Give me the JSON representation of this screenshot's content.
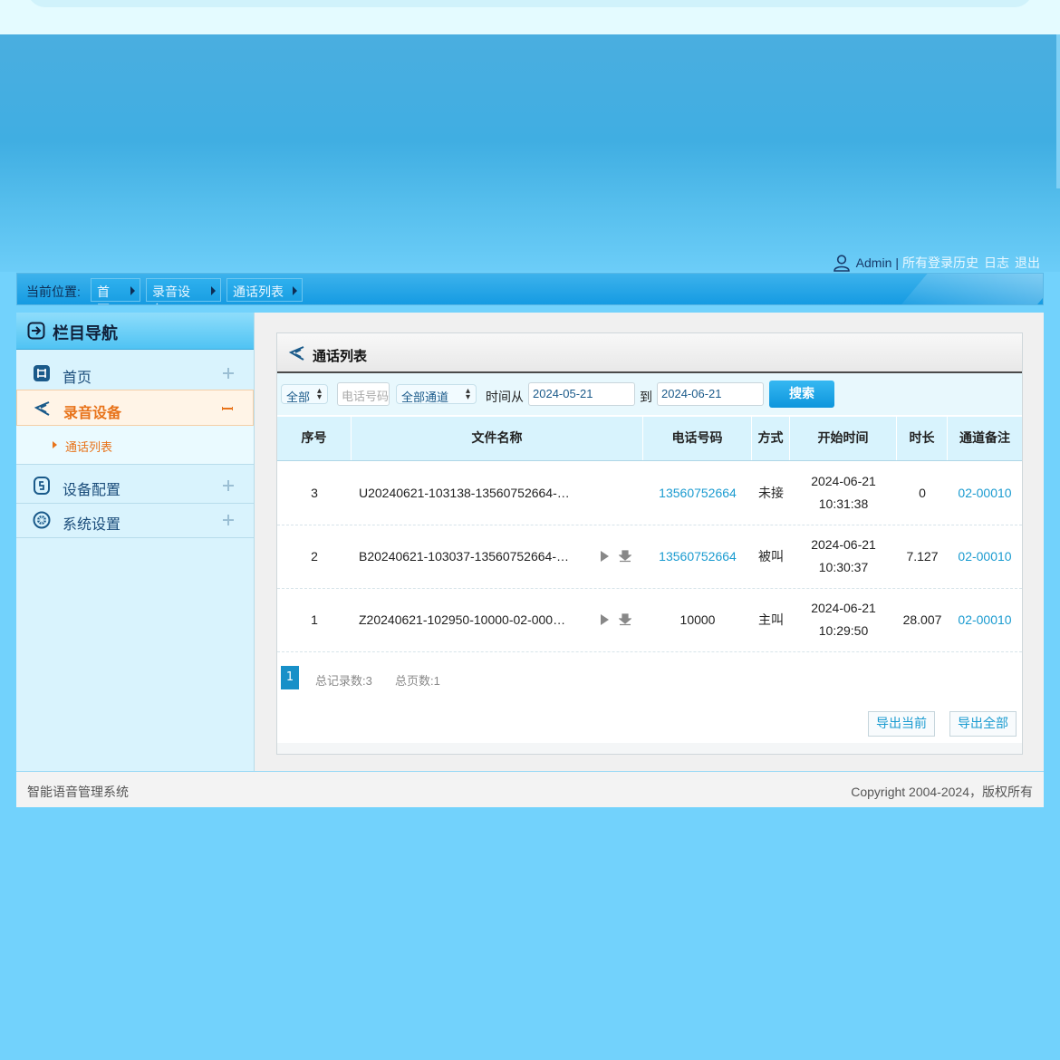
{
  "header": {
    "user": "Admin",
    "separator": "|",
    "links": [
      "所有登录历史",
      "日志",
      "退出"
    ]
  },
  "breadcrumb": {
    "label": "当前位置:",
    "items": [
      "首页",
      "录音设备",
      "通话列表"
    ]
  },
  "sidebar": {
    "title": "栏目导航",
    "items": [
      {
        "label": "首页",
        "icon": "home-grid-icon"
      },
      {
        "label": "录音设备",
        "icon": "recorder-icon"
      },
      {
        "label": "设备配置",
        "icon": "device-config-icon"
      },
      {
        "label": "系统设置",
        "icon": "system-settings-icon"
      }
    ],
    "subitems": [
      "通话列表"
    ]
  },
  "panel": {
    "title": "通话列表"
  },
  "search": {
    "type_select": "全部",
    "phone_placeholder": "电话号码",
    "channel_select": "全部通道",
    "time_from_label": "时间从",
    "date_from": "2024-05-21",
    "to_label": "到",
    "date_to": "2024-06-21",
    "search_button": "搜索"
  },
  "table": {
    "columns": [
      "序号",
      "文件名称",
      "电话号码",
      "方式",
      "开始时间",
      "时长",
      "通道备注"
    ],
    "rows": [
      {
        "index": "3",
        "file": "U20240621-103138-13560752664-…",
        "phone": "13560752664",
        "phone_link": true,
        "mode": "未接",
        "date": "2024-06-21",
        "time": "10:31:38",
        "duration": "0",
        "channel": "02-00010",
        "has_actions": false
      },
      {
        "index": "2",
        "file": "B20240621-103037-13560752664-…",
        "phone": "13560752664",
        "phone_link": true,
        "mode": "被叫",
        "date": "2024-06-21",
        "time": "10:30:37",
        "duration": "7.127",
        "channel": "02-00010",
        "has_actions": true
      },
      {
        "index": "1",
        "file": "Z20240621-102950-10000-02-000…",
        "phone": "10000",
        "phone_link": false,
        "mode": "主叫",
        "date": "2024-06-21",
        "time": "10:29:50",
        "duration": "28.007",
        "channel": "02-00010",
        "has_actions": true
      }
    ]
  },
  "pager": {
    "current": "1",
    "total_records": "总记录数:3",
    "total_pages": "总页数:1"
  },
  "export": {
    "current": "导出当前",
    "all": "导出全部"
  },
  "footer": {
    "left": "智能语音管理系统",
    "right": "Copyright 2004-2024，版权所有"
  },
  "colors": {
    "page_bg": "#72d2fc",
    "accent_orange": "#e8731a",
    "link_blue": "#1a9bd0"
  }
}
